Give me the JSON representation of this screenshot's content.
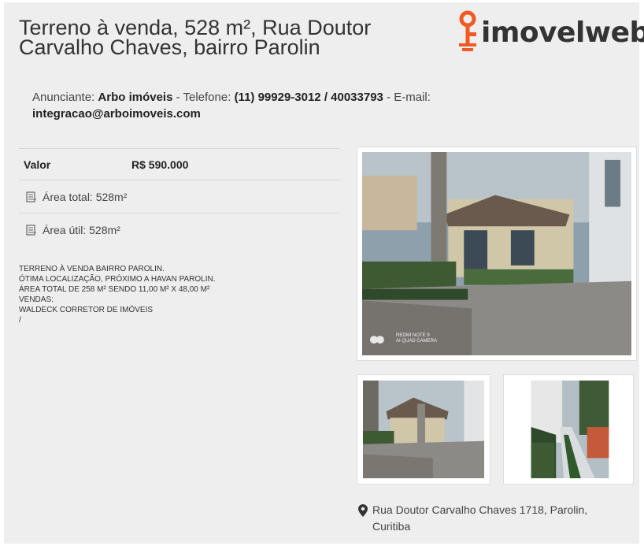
{
  "listing": {
    "title_line1": "Terreno à venda, 528 m², Rua Doutor",
    "title_line2": "Carvalho Chaves, bairro Parolin"
  },
  "brand": {
    "name": "imovelweb",
    "accent_color": "#f15a22"
  },
  "advertiser": {
    "label": "Anunciante:",
    "name": "Arbo imóveis",
    "phone_label": "- Telefone:",
    "phone": "(11) 99929-3012 / 40033793",
    "email_label": "- E-mail:",
    "email": "integracao@arboimoveis.com"
  },
  "specs": {
    "price_label": "Valor",
    "price_value": "R$ 590.000",
    "total_area": "Área total: 528m²",
    "useful_area": "Área útil: 528m²",
    "area_icon": "area-icon"
  },
  "description": {
    "lines": [
      "TERRENO À VENDA BAIRRO PAROLIN.",
      "ÓTIMA LOCALIZAÇÃO, PRÓXIMO A HAVAN PAROLIN.",
      "ÁREA TOTAL DE 258 M² SENDO 11,00 M² X 48,00 M²",
      "VENDAS:",
      "WALDECK CORRETOR DE IMÓVEIS",
      "/"
    ]
  },
  "photos": {
    "watermark_line1": "REDMI NOTE 9",
    "watermark_line2": "AI QUAD CAMERA"
  },
  "address": {
    "icon": "map-pin-icon",
    "line1": "Rua Doutor Carvalho Chaves 1718, Parolin,",
    "line2": "Curitiba"
  }
}
